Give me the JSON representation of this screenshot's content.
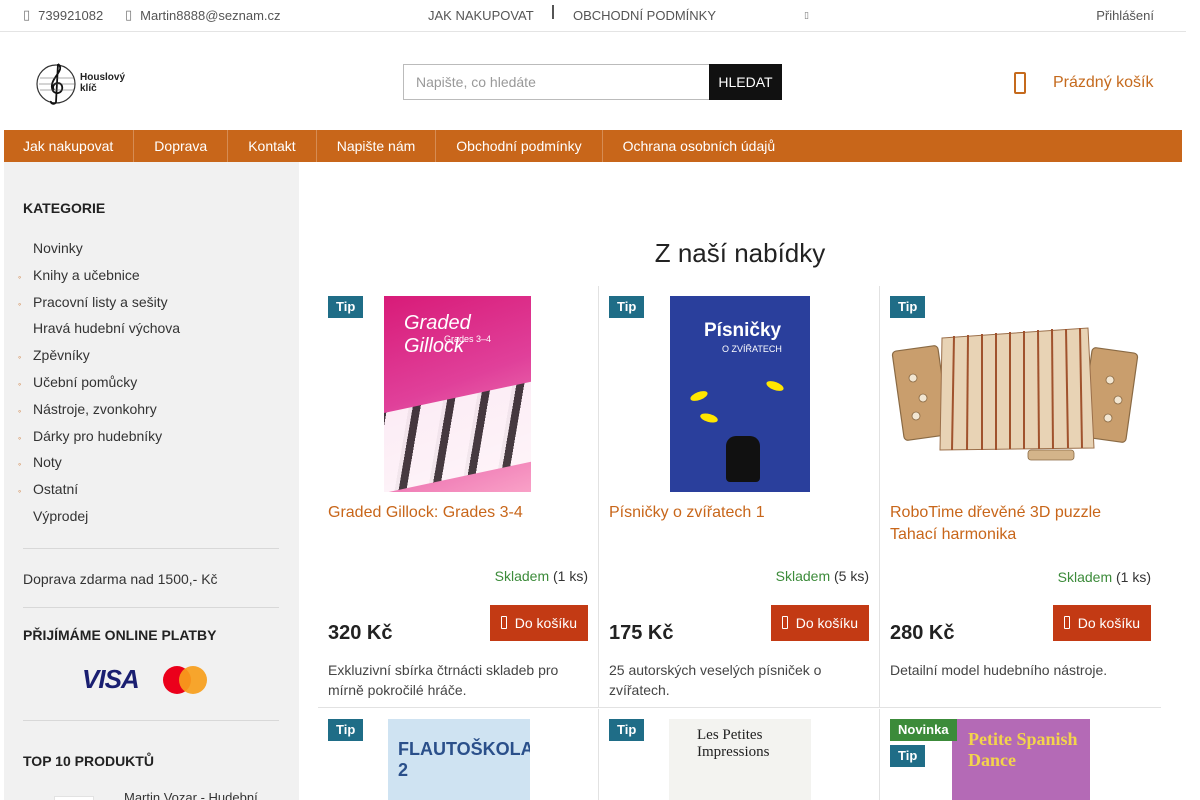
{
  "topbar": {
    "phone": "739921082",
    "email": "Martin8888@seznam.cz",
    "links": [
      "JAK NAKUPOVAT",
      "OBCHODNÍ PODMÍNKY"
    ],
    "login": "Přihlášení"
  },
  "header": {
    "logo_text": [
      "Houslový",
      "klíč"
    ],
    "search_placeholder": "Napište, co hledáte",
    "search_button": "HLEDAT",
    "cart_label": "Prázdný košík"
  },
  "nav": [
    "Jak nakupovat",
    "Doprava",
    "Kontakt",
    "Napište nám",
    "Obchodní podmínky",
    "Ochrana osobních údajů"
  ],
  "sidebar": {
    "categories_title": "KATEGORIE",
    "categories": [
      {
        "label": "Novinky",
        "bullet": false
      },
      {
        "label": "Knihy a učebnice",
        "bullet": true
      },
      {
        "label": "Pracovní listy a sešity",
        "bullet": true
      },
      {
        "label": "Hravá hudební výchova",
        "bullet": false
      },
      {
        "label": "Zpěvníky",
        "bullet": true
      },
      {
        "label": "Učební pomůcky",
        "bullet": true
      },
      {
        "label": "Nástroje, zvonkohry",
        "bullet": true
      },
      {
        "label": "Dárky pro hudebníky",
        "bullet": true
      },
      {
        "label": "Noty",
        "bullet": true
      },
      {
        "label": "Ostatní",
        "bullet": true
      },
      {
        "label": "Výprodej",
        "bullet": false
      }
    ],
    "shipping_note": "Doprava zdarma nad 1500,- Kč",
    "payments_title": "PŘIJÍMÁME ONLINE PLATBY",
    "visa_label": "VISA",
    "top_title": "TOP 10 PRODUKTŮ",
    "top_first": "Martin Vozar - Hudební"
  },
  "main": {
    "title": "Z naší nabídky",
    "products": [
      {
        "badges": [
          "Tip"
        ],
        "title": "Graded Gillock: Grades 3-4",
        "stock_status": "Skladem",
        "stock_qty": "(1 ks)",
        "price": "320 Kč",
        "buy": "Do košíku",
        "desc": "Exkluzivní sbírka čtrnácti skladeb pro mírně pokročilé hráče.",
        "cover_title": "Graded Gillock",
        "cover_sub": "Grades 3–4"
      },
      {
        "badges": [
          "Tip"
        ],
        "title": "Písničky o zvířatech 1",
        "stock_status": "Skladem",
        "stock_qty": "(5 ks)",
        "price": "175 Kč",
        "buy": "Do košíku",
        "desc": "25 autorských veselých písniček o zvířatech.",
        "cover_title": "Písničky",
        "cover_sub": "O ZVÍŘATECH"
      },
      {
        "badges": [
          "Tip"
        ],
        "title": "RoboTime dřevěné 3D puzzle Tahací harmonika",
        "stock_status": "Skladem",
        "stock_qty": "(1 ks)",
        "price": "280 Kč",
        "buy": "Do košíku",
        "desc": "Detailní model hudebního nástroje."
      }
    ],
    "row2": [
      {
        "badges": [
          "Tip"
        ],
        "cover_title": "FLAUTOŠKOLA 2"
      },
      {
        "badges": [
          "Tip"
        ],
        "cover_title": "Les Petites Impressions"
      },
      {
        "badges": [
          "Novinka",
          "Tip"
        ],
        "cover_title": "Petite Spanish Dance"
      }
    ]
  },
  "colors": {
    "accent": "#c8661a",
    "buy_button": "#c33a14",
    "tip_badge": "#1f6d87",
    "new_badge": "#3c8b3a",
    "stock_ok": "#3c8b3a"
  },
  "icons": [
    "phone-icon",
    "mail-icon",
    "gear-icon",
    "cart-icon",
    "cart-button-icon"
  ]
}
